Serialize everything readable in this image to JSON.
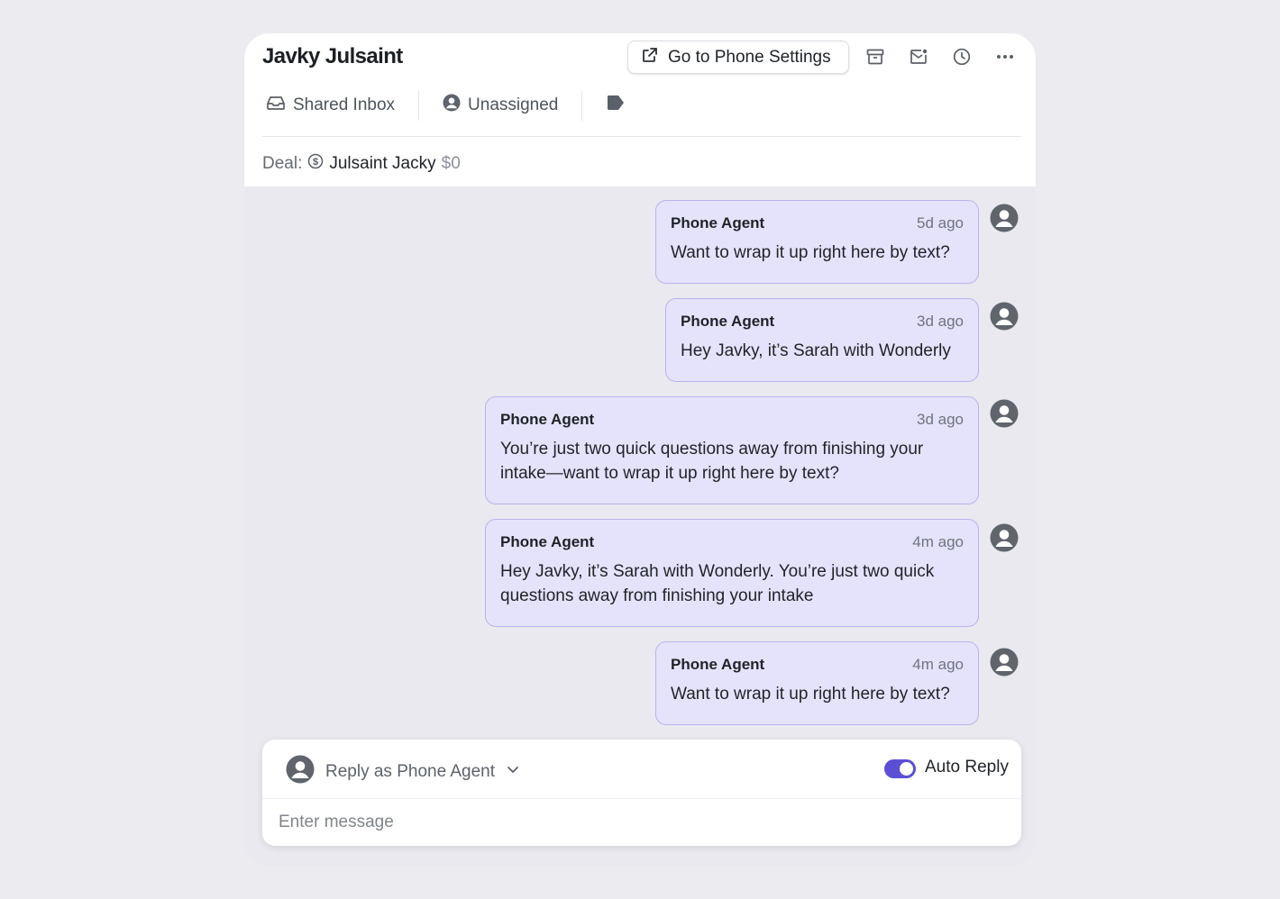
{
  "header": {
    "title": "Javky Julsaint",
    "settings_button_label": "Go to Phone Settings",
    "actions": [
      "archive-icon",
      "mail-icon",
      "clock-icon",
      "more-icon"
    ]
  },
  "meta": {
    "inbox_label": "Shared Inbox",
    "assignee_label": "Unassigned",
    "tag_icon": "tag-icon"
  },
  "deal": {
    "label": "Deal:",
    "name": "Julsaint Jacky",
    "amount": "$0"
  },
  "messages": [
    {
      "sender": "Phone Agent",
      "time": "5d ago",
      "text": "Want to wrap it up right here by text?"
    },
    {
      "sender": "Phone Agent",
      "time": "3d ago",
      "text": "Hey Javky, it’s Sarah with Wonderly"
    },
    {
      "sender": "Phone Agent",
      "time": "3d ago",
      "text": "You’re just two quick questions away from finishing your intake—want to wrap it up right here by text?"
    },
    {
      "sender": "Phone Agent",
      "time": "4m ago",
      "text": "Hey Javky, it’s Sarah with Wonderly. You’re just two quick questions away from finishing your intake"
    },
    {
      "sender": "Phone Agent",
      "time": "4m ago",
      "text": "Want to wrap it up right here by text?"
    }
  ],
  "composer": {
    "reply_as_label": "Reply as Phone Agent",
    "auto_reply_label": "Auto Reply",
    "auto_reply_enabled": true,
    "placeholder": "Enter message"
  },
  "colors": {
    "accent": "#5b4fd6",
    "bubble_bg": "#e5e3fb",
    "bubble_border": "#b9b2ef",
    "page_bg": "#ececf0"
  }
}
